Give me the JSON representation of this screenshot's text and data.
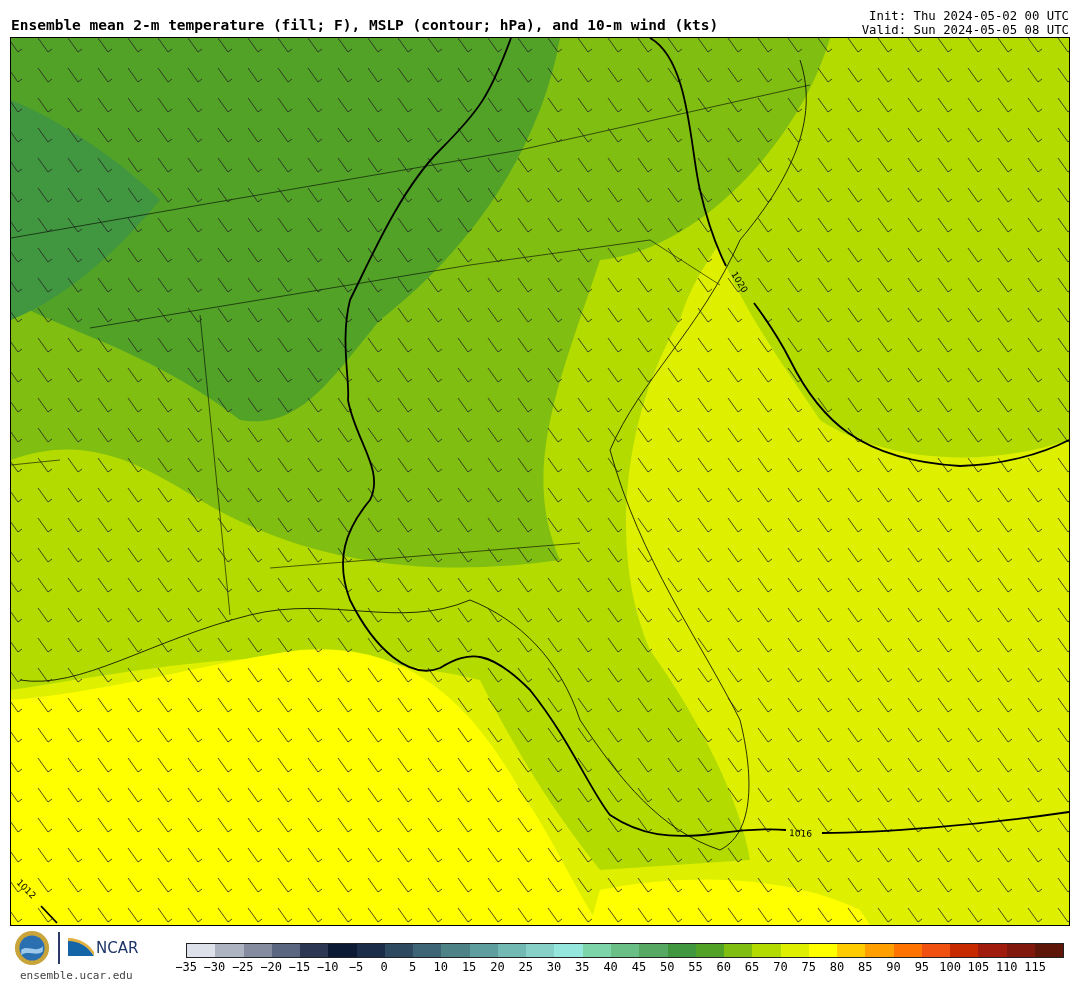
{
  "title": "Ensemble mean 2-m temperature (fill; F), MSLP (contour; hPa), and 10-m wind (kts)",
  "init": "Init: Thu 2024-05-02 00 UTC",
  "valid": "Valid: Sun 2024-05-05 08 UTC",
  "map": {
    "contours": [
      {
        "label": "1020"
      },
      {
        "label": "1016"
      },
      {
        "label": "1012"
      }
    ]
  },
  "org": "NCAR",
  "site": "ensemble.ucar.edu",
  "colorbar": {
    "bins": [
      {
        "color": "#dde1ea"
      },
      {
        "color": "#aeb3c1"
      },
      {
        "color": "#858c9f"
      },
      {
        "color": "#5a6680"
      },
      {
        "color": "#2c3753"
      },
      {
        "color": "#0d1a33"
      },
      {
        "color": "#1b2d48"
      },
      {
        "color": "#2d4a60"
      },
      {
        "color": "#3e6576"
      },
      {
        "color": "#4d8387"
      },
      {
        "color": "#5e9e9f"
      },
      {
        "color": "#72b8b3"
      },
      {
        "color": "#86d0c8"
      },
      {
        "color": "#95e6dc"
      },
      {
        "color": "#7ed4a9"
      },
      {
        "color": "#69bf85"
      },
      {
        "color": "#56a863"
      },
      {
        "color": "#419640"
      },
      {
        "color": "#52a228"
      },
      {
        "color": "#80be12"
      },
      {
        "color": "#b3db00"
      },
      {
        "color": "#def000"
      },
      {
        "color": "#ffff00"
      },
      {
        "color": "#ffcc00"
      },
      {
        "color": "#ff9f00"
      },
      {
        "color": "#ff7300"
      },
      {
        "color": "#f05010"
      },
      {
        "color": "#c82a00"
      },
      {
        "color": "#a01d0d"
      },
      {
        "color": "#80180d"
      },
      {
        "color": "#5e1608"
      }
    ],
    "ticks": [
      "−35",
      "−30",
      "−25",
      "−20",
      "−15",
      "−10",
      "−5",
      "0",
      "5",
      "10",
      "15",
      "20",
      "25",
      "30",
      "35",
      "40",
      "45",
      "50",
      "55",
      "60",
      "65",
      "70",
      "75",
      "80",
      "85",
      "90",
      "95",
      "100",
      "105",
      "110",
      "115"
    ]
  }
}
